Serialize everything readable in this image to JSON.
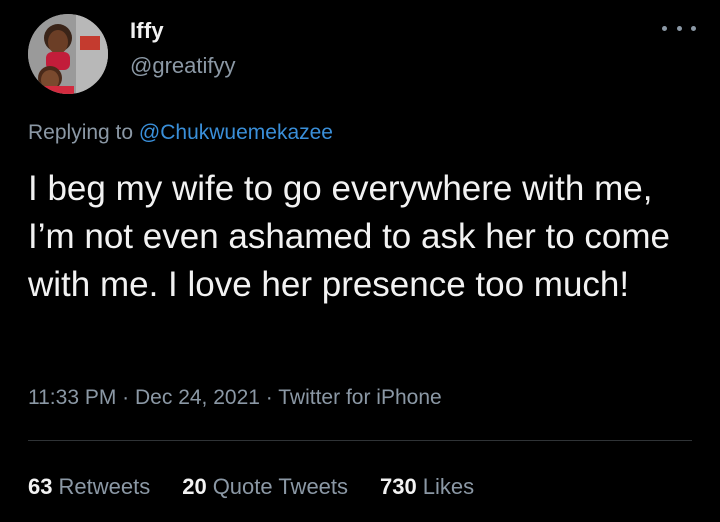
{
  "author": {
    "name": "Iffy",
    "handle": "@greatifyy"
  },
  "more_icon": "more-horizontal-icon",
  "reply": {
    "prefix": "Replying to",
    "mention": "@Chukwuemekazee"
  },
  "tweet": {
    "text": "I beg my wife to go everywhere with me, I’m not even ashamed to ask her to come with me. I love her presence too much!"
  },
  "meta": {
    "time": "11:33 PM",
    "sep1": "·",
    "date": "Dec 24, 2021",
    "sep2": "·",
    "source": "Twitter for iPhone"
  },
  "stats": {
    "retweets_count": "63",
    "retweets_label": "Retweets",
    "quotes_count": "20",
    "quotes_label": "Quote Tweets",
    "likes_count": "730",
    "likes_label": "Likes"
  },
  "colors": {
    "background": "#000000",
    "text": "#f2f2f2",
    "secondary": "#8b98a5",
    "link": "#3a8fd9",
    "divider": "#2f3336"
  }
}
